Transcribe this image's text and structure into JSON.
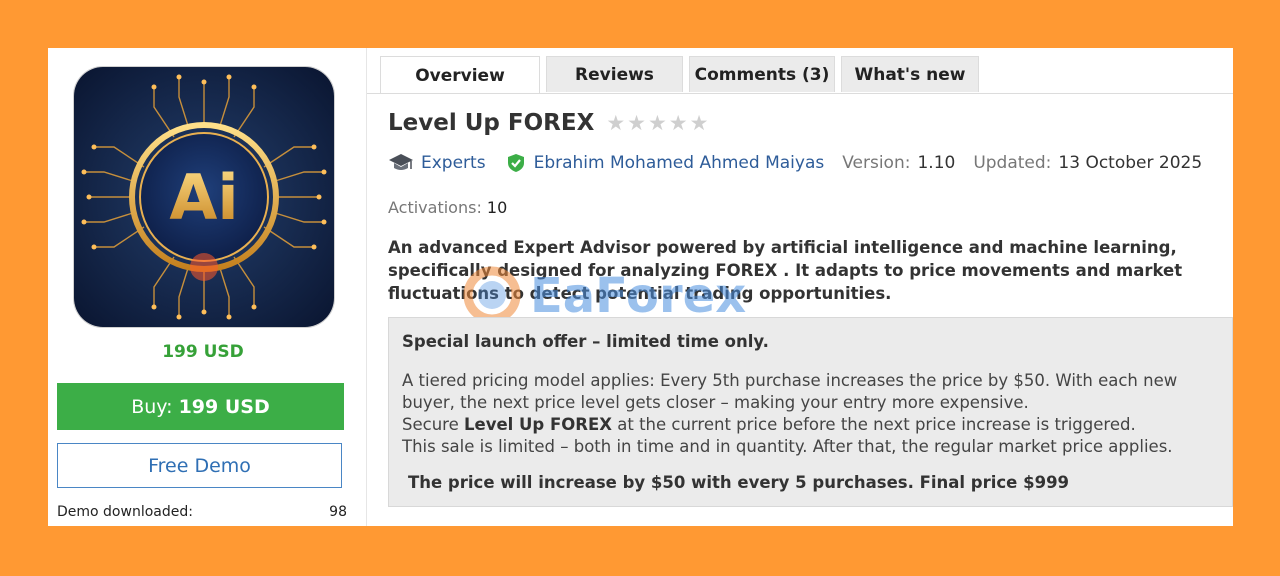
{
  "product": {
    "price_label": "199 USD",
    "buy_label": "Buy:",
    "buy_price": "199 USD",
    "demo_label": "Free Demo",
    "demo_downloaded_label": "Demo downloaded:",
    "demo_downloaded_value": "98",
    "image_text": "Ai"
  },
  "tabs": [
    {
      "label": "Overview",
      "active": true
    },
    {
      "label": "Reviews",
      "active": false
    },
    {
      "label": "Comments (3)",
      "active": false
    },
    {
      "label": "What's new",
      "active": false
    }
  ],
  "header": {
    "title": "Level Up FOREX",
    "rating_stars": 0,
    "category": "Experts",
    "author": "Ebrahim Mohamed Ahmed Maiyas",
    "version_label": "Version:",
    "version": "1.10",
    "updated_label": "Updated:",
    "updated": "13 October 2025",
    "activations_label": "Activations:",
    "activations": "10"
  },
  "description": "An advanced Expert Advisor powered by artificial intelligence and machine learning, specifically designed for analyzing FOREX . It adapts to price movements and market fluctuations to detect potential trading opportunities.",
  "offer": {
    "title": "Special launch offer – limited time only.",
    "line1": "A tiered pricing model applies: Every 5th purchase increases the price by $50. With each new buyer, the next price level gets closer – making your entry more expensive.",
    "line2_pre": "Secure ",
    "line2_bold": "Level Up FOREX",
    "line2_post": " at the current price before the next price increase is triggered.",
    "line3": "This sale is limited – both in time and in quantity. After that, the regular market price applies.",
    "final": "The price will increase by $50 with every 5 purchases. Final price $999"
  },
  "watermark": "EaForex",
  "colors": {
    "background": "#ff9933",
    "buy_button": "#3cae47",
    "price_green": "#36a138",
    "link_blue": "#2e5c99"
  },
  "icons": {
    "category": "mortarboard-icon",
    "verified": "verified-shield-icon",
    "star": "star-icon"
  }
}
